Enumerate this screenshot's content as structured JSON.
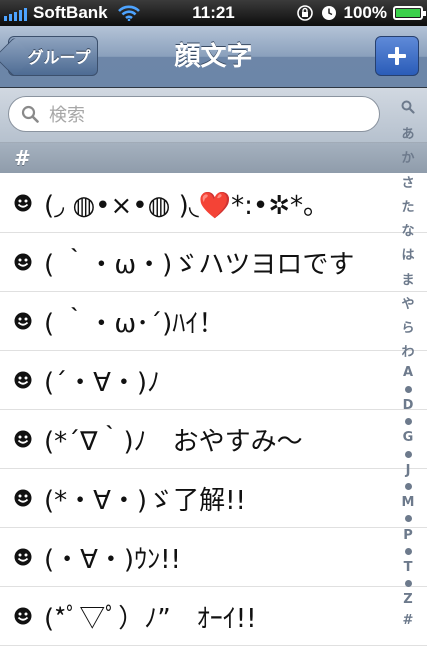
{
  "status": {
    "carrier": "SoftBank",
    "time": "11:21",
    "battery": "100%",
    "battery_level": 1.0
  },
  "nav": {
    "back_label": "グループ",
    "title": "顔文字",
    "add_label": "+"
  },
  "search": {
    "placeholder": "検索"
  },
  "section": {
    "header": "#"
  },
  "rows": [
    "(◞ ◍•×•◍ )◟❤️*:•✲*。",
    "( ｀・ω・)ゞハツヨロです",
    "( ｀・ω･´)ﾊｲ！",
    "(´・∀・)ﾉ",
    "(*´∇｀)ﾉ　おやすみ〜",
    "(*・∀・)ゞ了解!!",
    "(・∀・)ｳﾝ!!",
    "(*ﾟ▽ﾟ）ﾉ”　ｵｰｲ!!"
  ],
  "index": [
    "search",
    "あ",
    "か",
    "さ",
    "た",
    "な",
    "は",
    "ま",
    "や",
    "ら",
    "わ",
    "A",
    "•",
    "D",
    "•",
    "G",
    "•",
    "J",
    "•",
    "M",
    "•",
    "P",
    "•",
    "T",
    "•",
    "Z",
    "#"
  ],
  "colors": {
    "nav_tint": "#6d86a8",
    "add_button": "#2a5cb8",
    "signal": "#4da3ff",
    "battery_fill": "#3bd14b"
  }
}
